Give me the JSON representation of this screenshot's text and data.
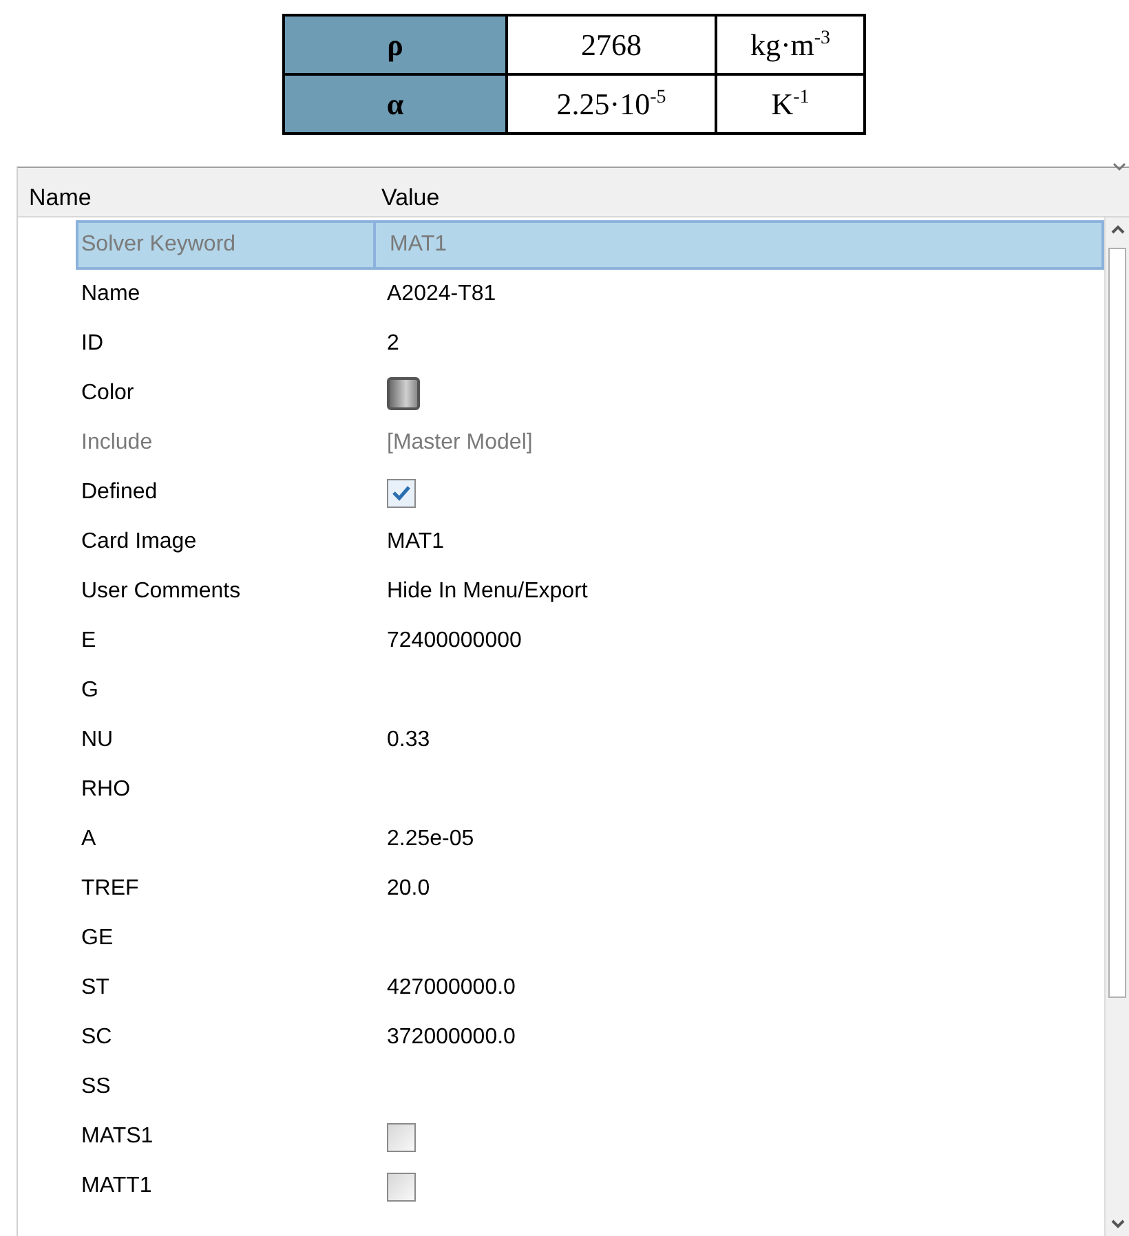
{
  "constants_table": {
    "rows": [
      {
        "symbol": "ρ",
        "value": "2768",
        "unit": "kg·m$^{-3}$"
      },
      {
        "symbol": "α",
        "value": "2.25·10$^{-5}$",
        "unit": "K$^{-1}$"
      }
    ]
  },
  "property_grid": {
    "columns": [
      "Name",
      "Value"
    ],
    "rows": [
      {
        "name": "Solver Keyword",
        "kind": "text",
        "value": "MAT1",
        "disabled": true,
        "selected": true
      },
      {
        "name": "Name",
        "kind": "text",
        "value": "A2024-T81",
        "disabled": false,
        "selected": false
      },
      {
        "name": "ID",
        "kind": "text",
        "value": "2",
        "disabled": false,
        "selected": false
      },
      {
        "name": "Color",
        "kind": "color",
        "disabled": false,
        "selected": false
      },
      {
        "name": "Include",
        "kind": "text",
        "value": "[Master Model]",
        "disabled": true,
        "selected": false
      },
      {
        "name": "Defined",
        "kind": "checkbox",
        "checked": true,
        "disabled": false,
        "selected": false
      },
      {
        "name": "Card Image",
        "kind": "text",
        "value": "MAT1",
        "disabled": false,
        "selected": false
      },
      {
        "name": "User Comments",
        "kind": "text",
        "value": "Hide In Menu/Export",
        "disabled": false,
        "selected": false
      },
      {
        "name": "E",
        "kind": "text",
        "value": "72400000000",
        "disabled": false,
        "selected": false
      },
      {
        "name": "G",
        "kind": "text",
        "disabled": false,
        "selected": false
      },
      {
        "name": "NU",
        "kind": "text",
        "value": "0.33",
        "disabled": false,
        "selected": false
      },
      {
        "name": "RHO",
        "kind": "text",
        "disabled": false,
        "selected": false
      },
      {
        "name": "A",
        "kind": "text",
        "value": "2.25e-05",
        "disabled": false,
        "selected": false
      },
      {
        "name": "TREF",
        "kind": "text",
        "value": "20.0",
        "disabled": false,
        "selected": false
      },
      {
        "name": "GE",
        "kind": "text",
        "disabled": false,
        "selected": false
      },
      {
        "name": "ST",
        "kind": "text",
        "value": "427000000.0",
        "disabled": false,
        "selected": false
      },
      {
        "name": "SC",
        "kind": "text",
        "value": "372000000.0",
        "disabled": false,
        "selected": false
      },
      {
        "name": "SS",
        "kind": "text",
        "disabled": false,
        "selected": false
      },
      {
        "name": "MATS1",
        "kind": "checkbox",
        "checked": false,
        "disabled": false,
        "selected": false
      },
      {
        "name": "MATT1",
        "kind": "checkbox",
        "checked": false,
        "disabled": false,
        "selected": false
      }
    ]
  }
}
